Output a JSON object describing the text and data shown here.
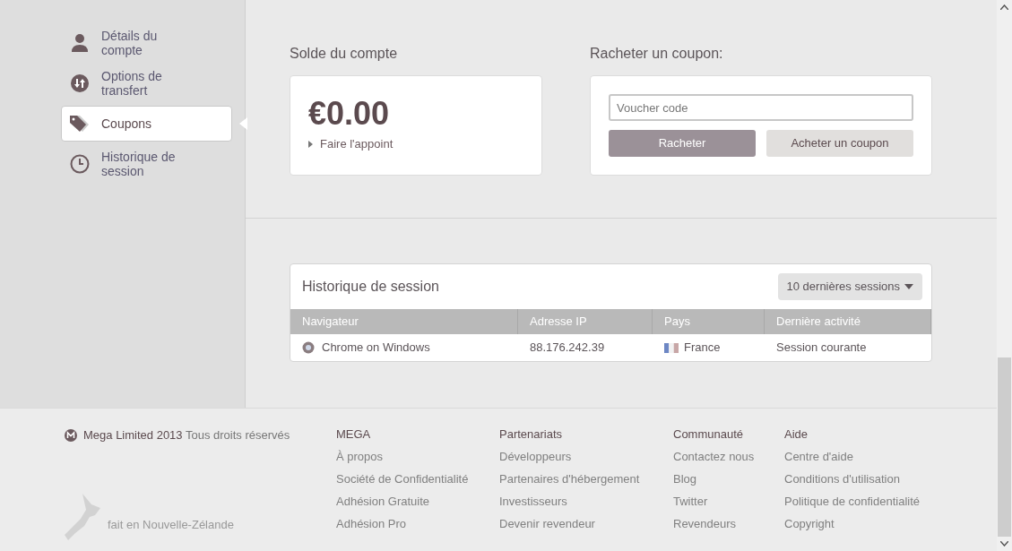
{
  "sidebar": {
    "items": [
      {
        "label": "Détails du compte",
        "selected": false
      },
      {
        "label": "Options de transfert",
        "selected": false
      },
      {
        "label": "Coupons",
        "selected": true
      },
      {
        "label": "Historique de session",
        "selected": false
      }
    ]
  },
  "balance": {
    "heading": "Solde du compte",
    "amount": "€0.00",
    "link": "Faire l'appoint"
  },
  "redeem": {
    "heading": "Racheter un coupon:",
    "placeholder": "Voucher code",
    "buttons": [
      "Racheter",
      "Acheter un coupon"
    ]
  },
  "sessions": {
    "title": "Historique de session",
    "dropdown": "10 dernières sessions",
    "columns": [
      "Navigateur",
      "Adresse IP",
      "Pays",
      "Dernière activité"
    ],
    "rows": [
      {
        "browser": "Chrome on Windows",
        "ip": "88.176.242.39",
        "country": "France",
        "activity": "Session courante"
      }
    ]
  },
  "footer": {
    "company": "Mega Limited 2013",
    "rights": "Tous droits réservés",
    "made_in": "fait en Nouvelle-Zélande",
    "columns": [
      {
        "heading": "MEGA",
        "links": [
          "À propos",
          "Société de Confidentialité",
          "Adhésion Gratuite",
          "Adhésion Pro"
        ]
      },
      {
        "heading": "Partenariats",
        "links": [
          "Développeurs",
          "Partenaires d'hébergement",
          "Investisseurs",
          "Devenir revendeur"
        ]
      },
      {
        "heading": "Communauté",
        "links": [
          "Contactez nous",
          "Blog",
          "Twitter",
          "Revendeurs"
        ]
      },
      {
        "heading": "Aide",
        "links": [
          "Centre d'aide",
          "Conditions d'utilisation",
          "Politique de confidentialité",
          "Copyright"
        ]
      }
    ]
  }
}
